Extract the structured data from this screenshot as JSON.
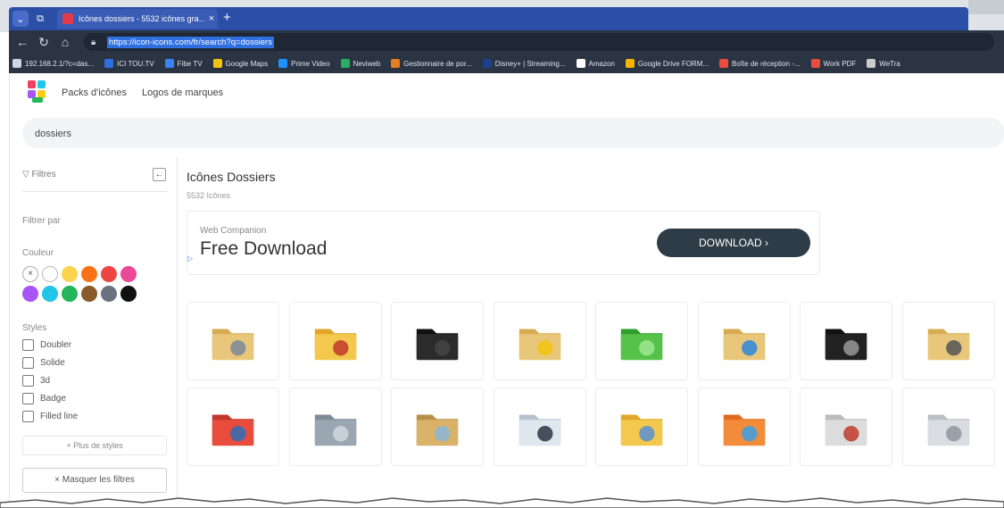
{
  "browser": {
    "tab_title": "Icônes dossiers - 5532 icônes gra…",
    "tab_close": "×",
    "new_tab": "+",
    "url": "https://icon-icons.com/fr/search?q=dossiers",
    "bookmarks": [
      {
        "label": "192.168.2.1/?c=das...",
        "color": "#cfd6df"
      },
      {
        "label": "ICI TOU.TV",
        "color": "#2f6fe0"
      },
      {
        "label": "Fibe TV",
        "color": "#3b82f6"
      },
      {
        "label": "Google Maps",
        "color": "#f1c40f"
      },
      {
        "label": "Prime Video",
        "color": "#1e90ff"
      },
      {
        "label": "Neviweb",
        "color": "#27ae60"
      },
      {
        "label": "Gestionnaire de por...",
        "color": "#e67e22"
      },
      {
        "label": "Disney+ | Streaming...",
        "color": "#1c3f8f"
      },
      {
        "label": "Amazon",
        "color": "#ffffff"
      },
      {
        "label": "Google Drive FORM...",
        "color": "#f4b400"
      },
      {
        "label": "Boîte de réception -...",
        "color": "#e74c3c"
      },
      {
        "label": "Work PDF",
        "color": "#e74c3c"
      },
      {
        "label": "WeTra",
        "color": "#cccccc"
      }
    ]
  },
  "header": {
    "links": [
      "Packs d'icônes",
      "Logos de marques"
    ]
  },
  "search": {
    "value": "dossiers"
  },
  "sidebar": {
    "filter_label": "Filtres",
    "collapse_icon": "←",
    "filter_by": "Filtrer par",
    "color_label": "Couleur",
    "clear_color": "×",
    "colors": [
      "#ffffff",
      "#fcd34d",
      "#f97316",
      "#ef4444",
      "#ec4899",
      "#a855f7",
      "#22c5e8",
      "#22b55a",
      "#8b5a2b",
      "#6b7280",
      "#111111"
    ],
    "styles_label": "Styles",
    "styles": [
      "Doubler",
      "Solide",
      "3d",
      "Badge",
      "Filled line"
    ],
    "more_styles": "Plus de styles",
    "hide_filters": "Masquer les filtres"
  },
  "main": {
    "title": "Icônes Dossiers",
    "count": "5532 Icônes"
  },
  "ad": {
    "source": "Web Companion",
    "headline": "Free Download",
    "button": "DOWNLOAD ›"
  },
  "icons": [
    "document-folder-icon",
    "tools-folder-icon",
    "black-folder-icon",
    "star-folder-icon",
    "green-open-folder-icon",
    "globe-folder-icon",
    "trash-folder-icon",
    "printer-folder-icon",
    "red-drawer-folder-icon",
    "music-folder-icon",
    "photo-folder-icon",
    "games-folder-icon",
    "pictures-folder-icon",
    "orange-folder-icon",
    "heart-folder-icon",
    "gray-folders-icon"
  ]
}
